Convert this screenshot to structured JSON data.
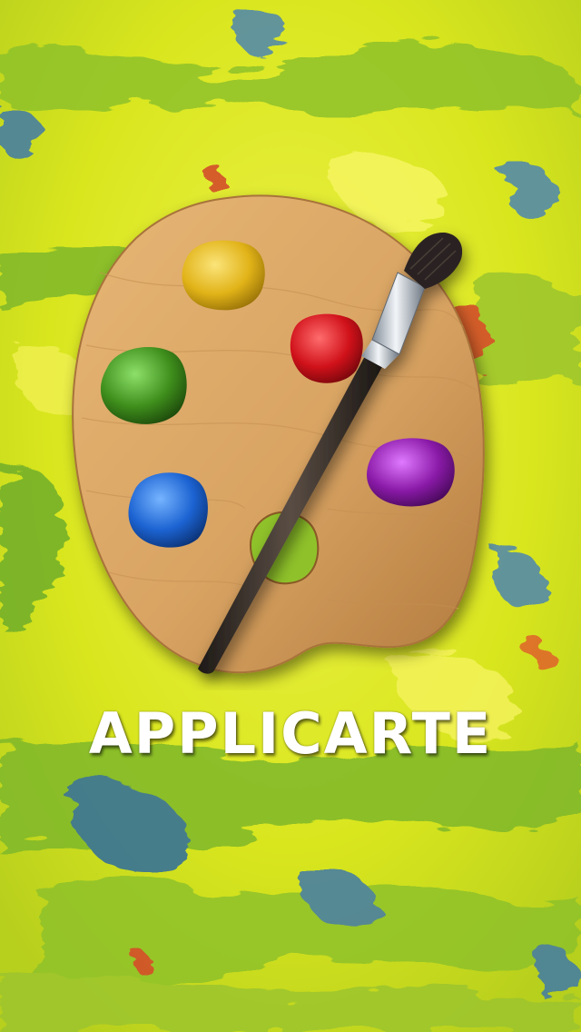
{
  "app": {
    "title": "APPLICARTE"
  },
  "splash": {
    "background_colors": {
      "base": "#d9e61e",
      "light": "#eef24a",
      "green": "#7fb82a",
      "blue": "#3f7aa8",
      "red": "#d2452a"
    },
    "palette": {
      "wood": "#d9a463",
      "wood_dark": "#b27a3e",
      "paints": {
        "yellow": "#e1b318",
        "red": "#d0111a",
        "green": "#3f8f1c",
        "blue": "#1c63d2",
        "purple": "#8a1aa8"
      }
    }
  }
}
